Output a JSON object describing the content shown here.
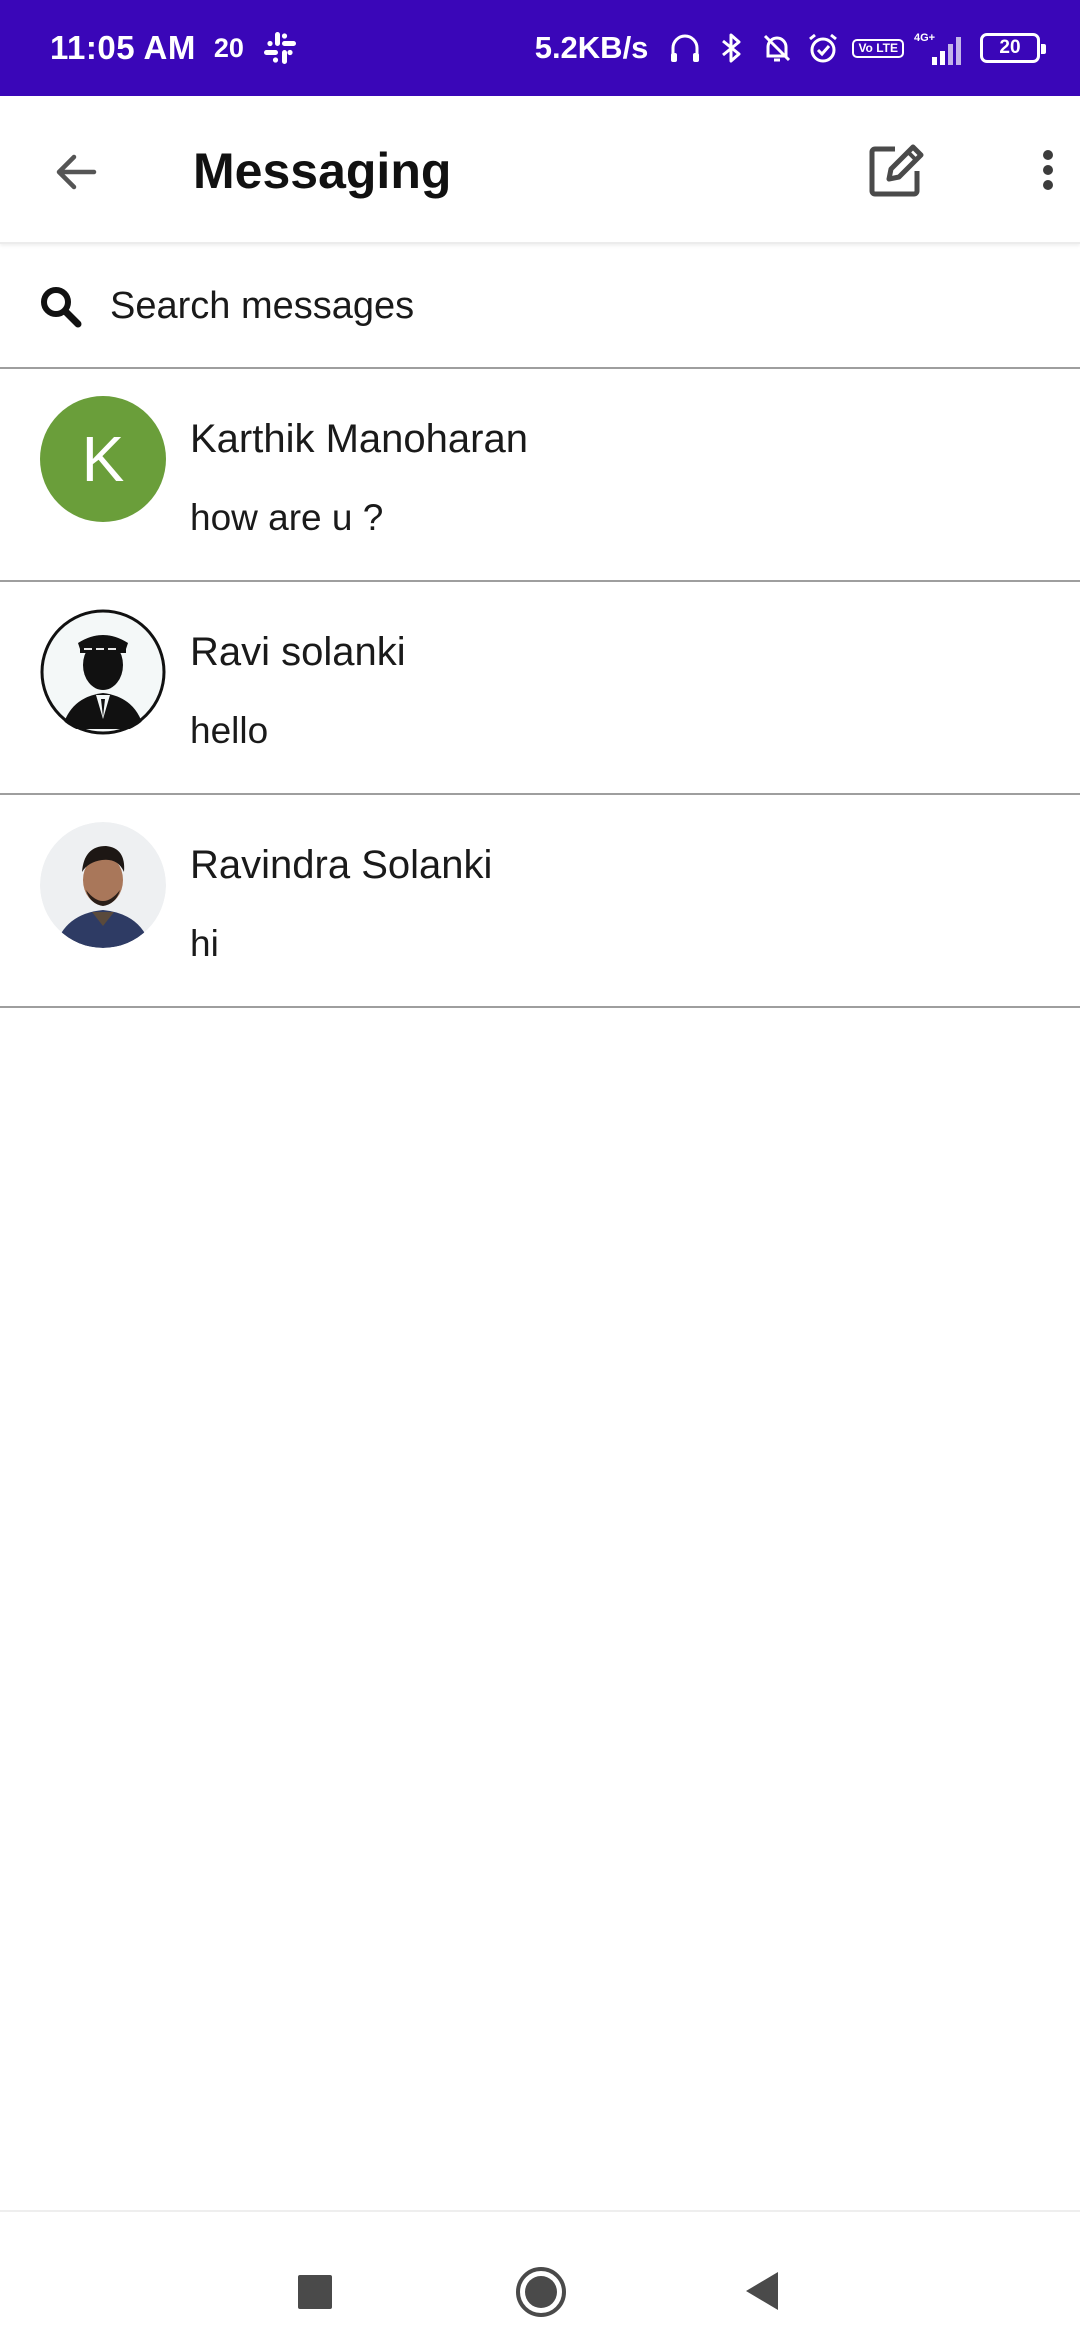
{
  "status_bar": {
    "time": "11:05 AM",
    "notification_count": "20",
    "net_speed": "5.2KB/s",
    "volte_label": "Vo LTE",
    "network_label": "4G+",
    "battery": "20",
    "background_color": "#3a06b8"
  },
  "app_bar": {
    "title": "Messaging",
    "icons": [
      "back-arrow-icon",
      "compose-icon",
      "more-vert-icon"
    ]
  },
  "search": {
    "placeholder": "Search messages",
    "value": ""
  },
  "conversations": [
    {
      "name": "Karthik Manoharan",
      "last_message": "how are u ?",
      "avatar_letter": "K",
      "avatar_color": "#6a9e3a"
    },
    {
      "name": "Ravi solanki",
      "last_message": "hello",
      "avatar_letter": "",
      "avatar_color": ""
    },
    {
      "name": "Ravindra Solanki",
      "last_message": "hi",
      "avatar_letter": "",
      "avatar_color": ""
    }
  ],
  "nav_bar": {
    "icons": [
      "recents-square-icon",
      "home-circle-icon",
      "back-triangle-icon"
    ]
  }
}
